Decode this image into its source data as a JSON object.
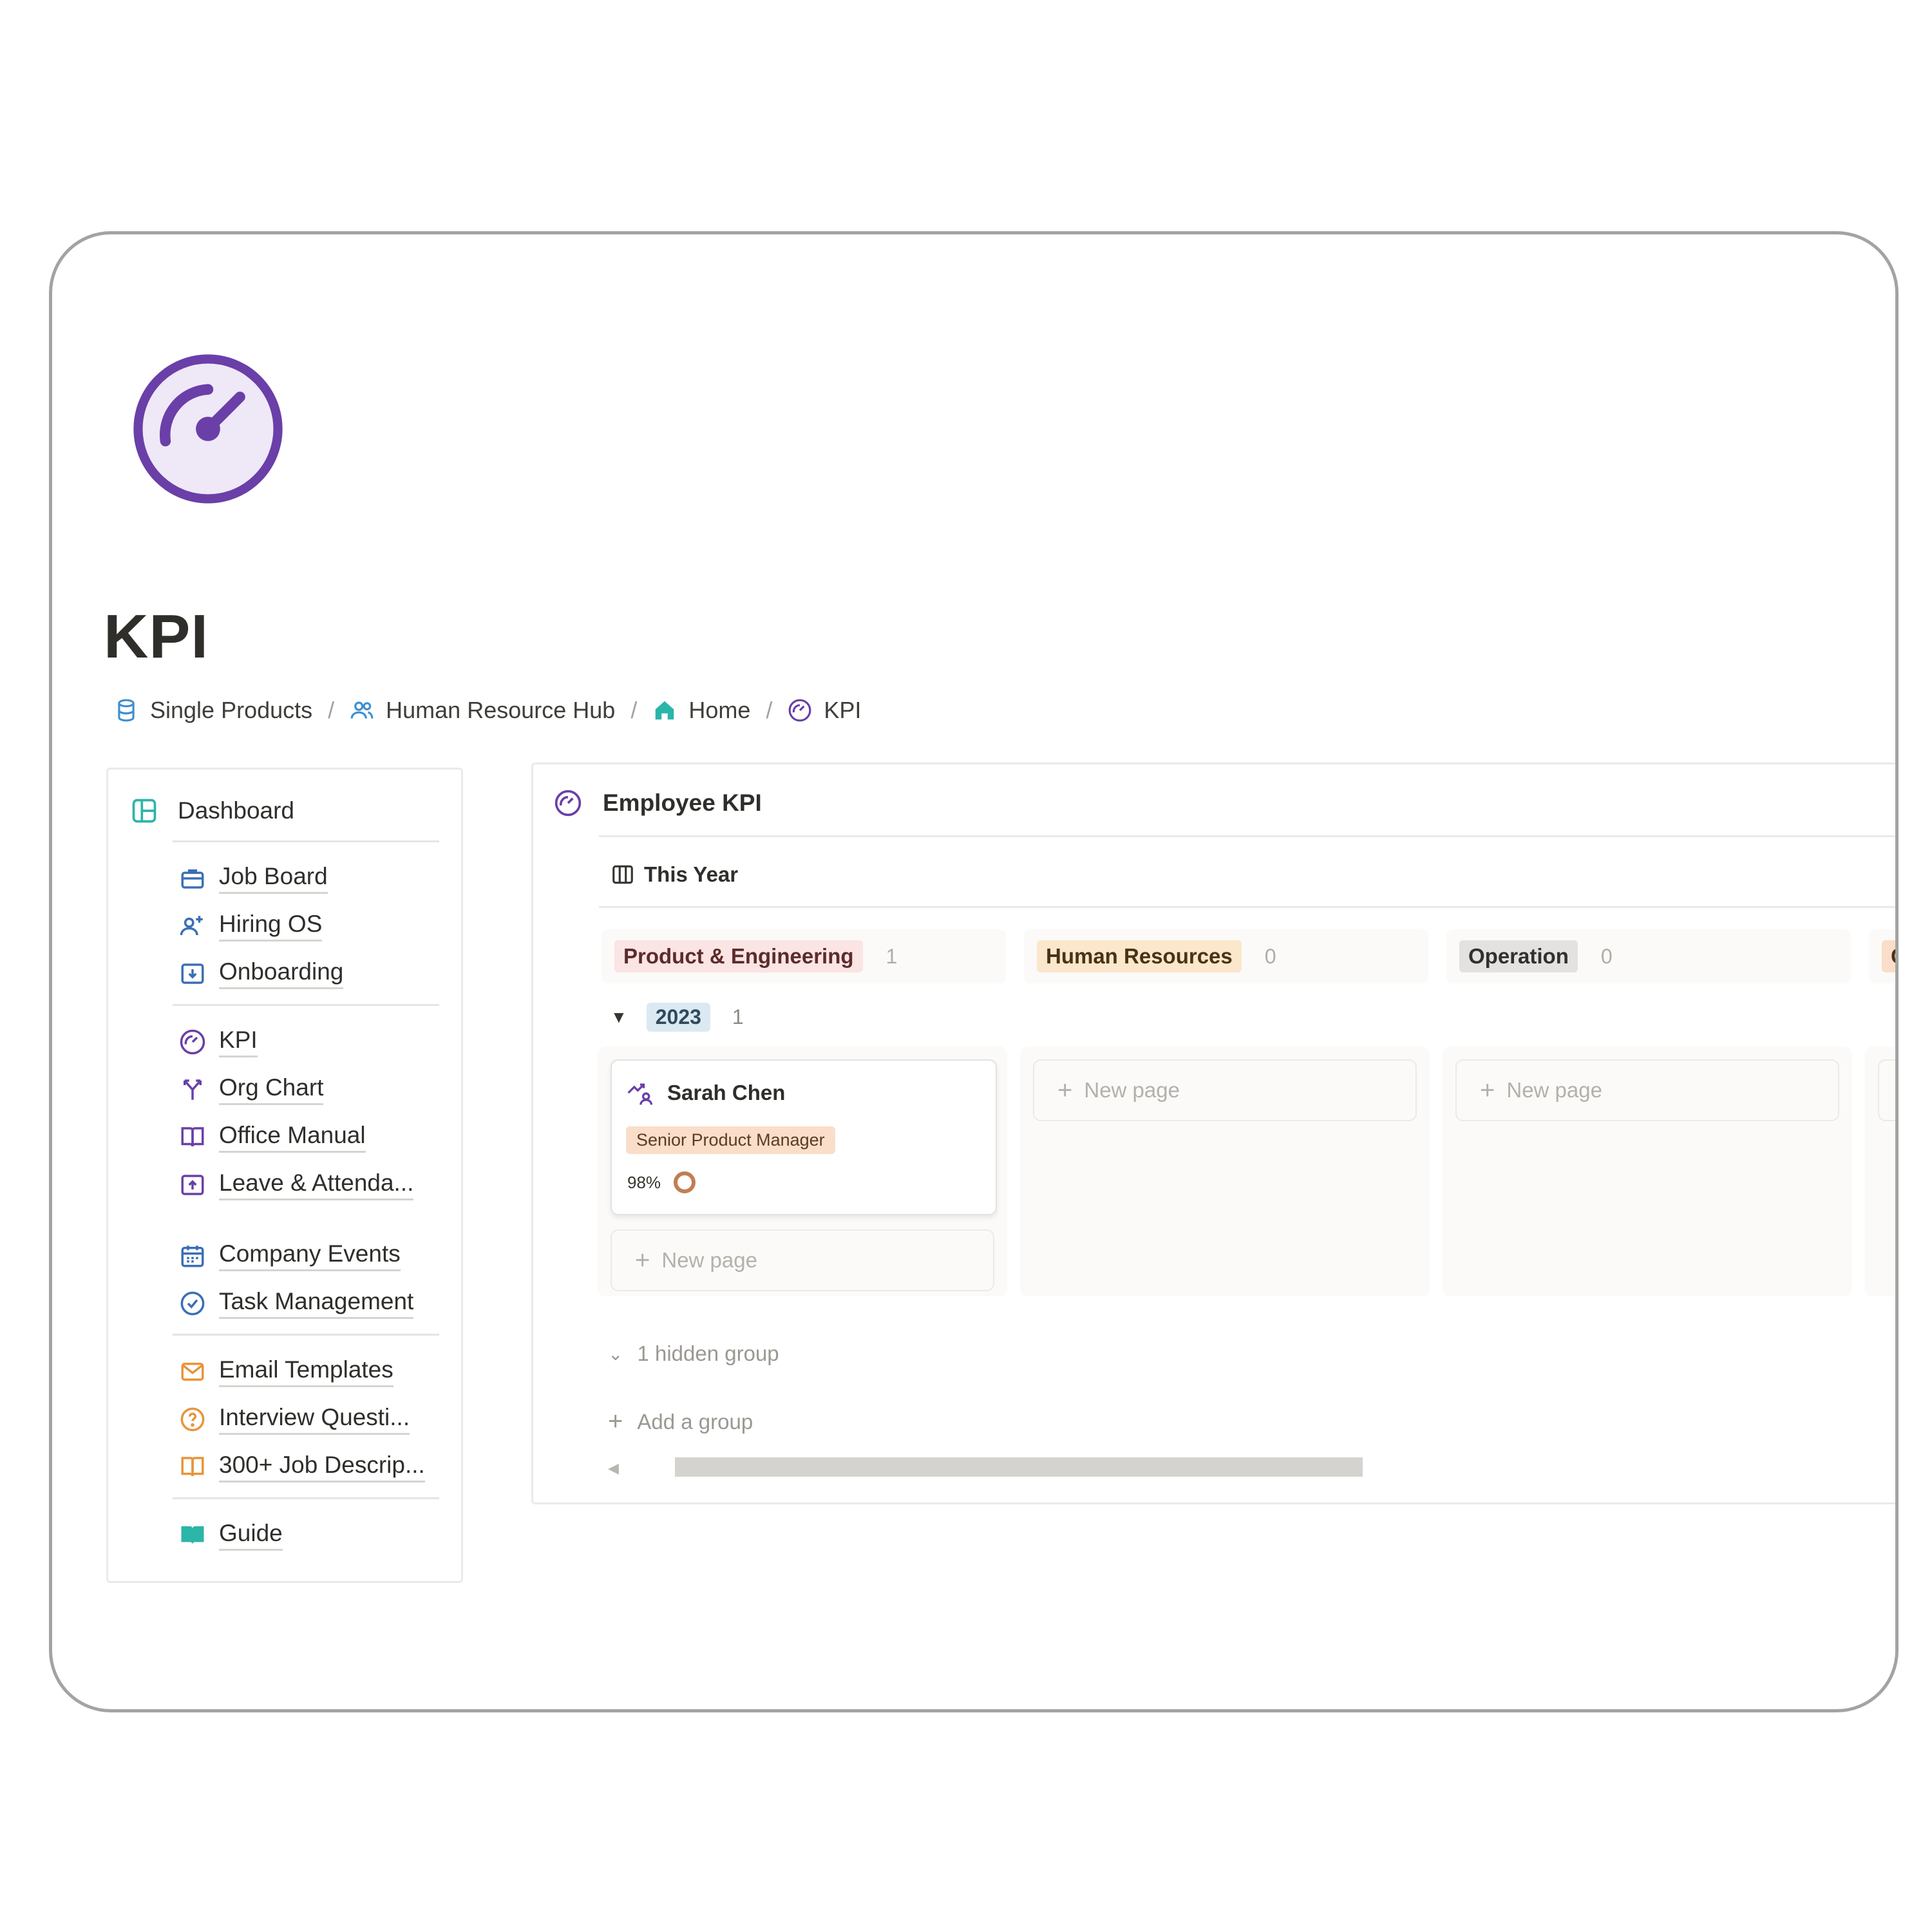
{
  "page": {
    "title": "KPI",
    "icon": "gauge-icon"
  },
  "breadcrumb": [
    {
      "label": "Single Products",
      "icon": "database-icon"
    },
    {
      "label": "Human Resource Hub",
      "icon": "people-icon"
    },
    {
      "label": "Home",
      "icon": "home-icon"
    },
    {
      "label": "KPI",
      "icon": "gauge-icon"
    }
  ],
  "breadcrumb_separator": "/",
  "sidebar": {
    "header": {
      "label": "Dashboard",
      "icon": "dashboard-icon"
    },
    "items": [
      {
        "label": "Job Board",
        "icon": "briefcase-icon"
      },
      {
        "label": "Hiring OS",
        "icon": "add-person-icon"
      },
      {
        "label": "Onboarding",
        "icon": "download-box-icon"
      },
      {
        "label": "KPI",
        "icon": "gauge-icon"
      },
      {
        "label": "Org Chart",
        "icon": "fork-arrows-icon"
      },
      {
        "label": "Office Manual",
        "icon": "book-icon"
      },
      {
        "label": "Leave & Attenda...",
        "icon": "upload-box-icon"
      },
      {
        "label": "Company Events",
        "icon": "calendar-icon"
      },
      {
        "label": "Task Management",
        "icon": "check-circle-icon"
      },
      {
        "label": "Email Templates",
        "icon": "envelope-icon"
      },
      {
        "label": "Interview Questi...",
        "icon": "question-circle-icon"
      },
      {
        "label": "300+ Job Descrip...",
        "icon": "open-book-icon"
      },
      {
        "label": "Guide",
        "icon": "teal-book-icon"
      }
    ]
  },
  "database": {
    "title": "Employee KPI",
    "icon": "gauge-icon",
    "view": {
      "label": "This Year",
      "icon": "board-view-icon"
    },
    "columns": [
      {
        "label": "Product & Engineering",
        "count": "1",
        "bg": "#fbe4e4",
        "fg": "#5c2b2b"
      },
      {
        "label": "Human Resources",
        "count": "0",
        "bg": "#fbe7cc",
        "fg": "#4a3214"
      },
      {
        "label": "Operation",
        "count": "0",
        "bg": "#e3e2e0",
        "fg": "#32302c"
      },
      {
        "label": "C",
        "count": "",
        "bg": "#fadec9",
        "fg": "#4a3214"
      }
    ],
    "group": {
      "label": "2023",
      "count": "1"
    },
    "card": {
      "name": "Sarah Chen",
      "name_icon": "growth-person-icon",
      "role": "Senior Product Manager",
      "kpi_value": "98%",
      "kpi_fraction": 0.98,
      "ring_color": "#c37d52"
    },
    "new_page_label": "New page",
    "hidden_group_label": "1 hidden group",
    "add_group_label": "Add a group"
  },
  "colors": {
    "accent_purple": "#6a3fa8",
    "accent_teal": "#2bb5a8",
    "border": "#a3a3a3"
  }
}
